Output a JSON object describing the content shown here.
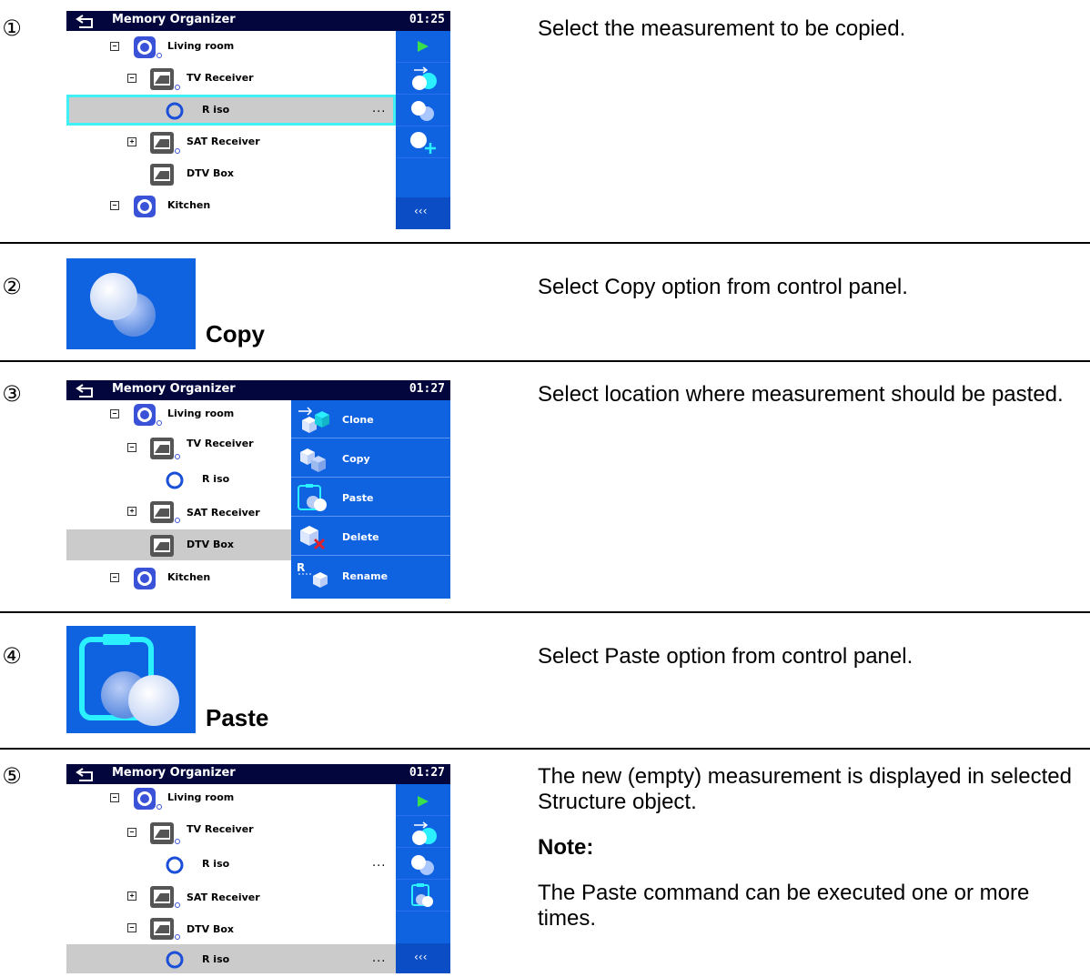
{
  "steps": [
    {
      "num": "①",
      "text": "Select the measurement to be copied."
    },
    {
      "num": "②",
      "text": "Select Copy option from control panel."
    },
    {
      "num": "③",
      "text": "Select location where measurement should be pasted."
    },
    {
      "num": "④",
      "text": "Select Paste option from control panel."
    },
    {
      "num": "⑤",
      "text": "The new (empty) measurement is displayed in selected Structure object.",
      "note_label": "Note:",
      "note_text": "The Paste command can be executed one or more times."
    }
  ],
  "screen1": {
    "title": "Memory Organizer",
    "time": "01:25",
    "rows": [
      "Living room",
      "TV Receiver",
      "R iso",
      "SAT Receiver",
      "DTV Box",
      "Kitchen"
    ],
    "dots": "...",
    "more": "‹‹‹"
  },
  "copy_label": "Copy",
  "screen3": {
    "title": "Memory Organizer",
    "time": "01:27",
    "rows": [
      "Living room",
      "TV Receiver",
      "R iso",
      "SAT Receiver",
      "DTV Box",
      "Kitchen"
    ],
    "menu": [
      "Clone",
      "Copy",
      "Paste",
      "Delete",
      "Rename"
    ]
  },
  "paste_label": "Paste",
  "screen5": {
    "title": "Memory Organizer",
    "time": "01:27",
    "rows": [
      "Living room",
      "TV Receiver",
      "R iso",
      "SAT Receiver",
      "DTV Box",
      "R iso"
    ],
    "dots": "...",
    "more": "‹‹‹"
  },
  "colors": {
    "titlebar": "#02063d",
    "panel": "#0f62e0",
    "highlight": "#3ff0f5",
    "selected": "#cbcbcb"
  }
}
